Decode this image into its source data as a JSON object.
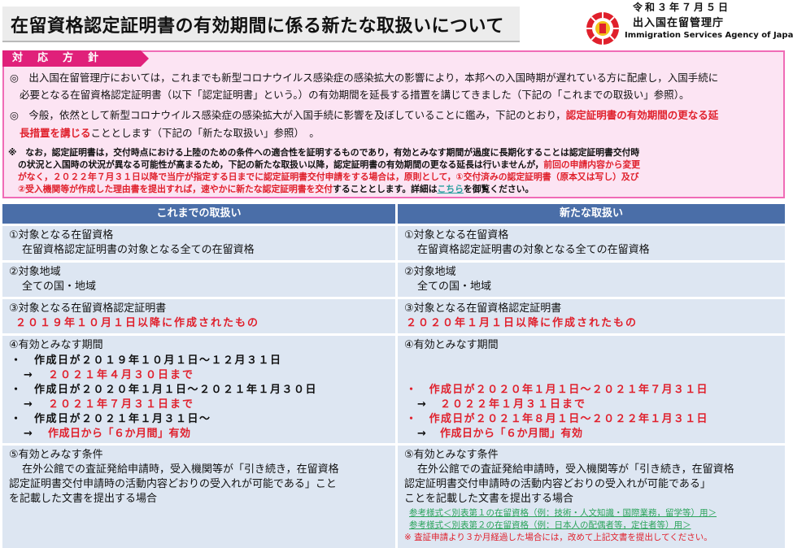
{
  "header": {
    "title": "在留資格認定証明書の有効期間に係る新たな取扱いについて",
    "date": "令和３年７月５日",
    "agency_ja": "出入国在留管理庁",
    "agency_en": "Immigration Services Agency of Japan",
    "logo_icon": "agency-emblem-icon"
  },
  "policy": {
    "tab_label": "対応方針",
    "line1": "◎　出入国在留管理庁においては，これまでも新型コロナウイルス感染症の感染拡大の影響により，本邦への入国時期が遅れている方に配慮し，入国手続に",
    "line2": "必要となる在留資格認定証明書（以下「認定証明書」という。）の有効期間を延長する措置を講じてきました（下記の「これまでの取扱い」参照）。",
    "line3a": "◎　今般，依然として新型コロナウイルス感染症の感染拡大が入国手続に影響を及ぼしていることに鑑み，下記のとおり，",
    "line3b": "認定証明書の有効期間の更なる延",
    "line4a": "長措置を講じる",
    "line4b": "こととします（下記の「新たな取扱い」参照）　。",
    "note1": "※　なお，認定証明書は，交付時点における上陸のための条件への適合性を証明するものであり，有効とみなす期間が過度に長期化することは認定証明書交付時",
    "note2a": "の状況と入国時の状況が異なる可能性が高まるため，下記の新たな取扱い以降，認定証明書の有効期間の更なる延長は行いませんが，",
    "note2b": "前回の申請内容から変更",
    "note3a": "がなく，２０２２年７月３１日以降で当庁が指定する日までに認定証明書交付申請をする場合は，原則として，①交付済みの認定証明書（原本又は写し）及び",
    "note4a": "②受入機関等が作成した理由書を提出すれば，",
    "note4b": "速やかに新たな認定証明書を交付",
    "note4c": "することとします。詳細は",
    "note4link": "こちら",
    "note4d": "を御覧ください。"
  },
  "table": {
    "left_header": "これまでの取扱い",
    "right_header": "新たな取扱い",
    "left": {
      "r1_title": "①対象となる在留資格",
      "r1_body": "在留資格認定証明書の対象となる全ての在留資格",
      "r2_title": "②対象地域",
      "r2_body": "全ての国・地域",
      "r3_title": "③対象となる在留資格認定証明書",
      "r3_body": "２０１９年１０月１日以降に作成されたもの",
      "r4_title": "④有効とみなす期間",
      "r4_l1": "・　作成日が２０１９年１０月１日～１２月３１日",
      "r4_l2a": "→",
      "r4_l2b": "２０２１年４月３０日まで",
      "r4_l3": "・　作成日が２０２０年１月１日～２０２１年１月３０日",
      "r4_l4a": "→",
      "r4_l4b": "２０２１年７月３１日まで",
      "r4_l5": "・　作成日が２０２１年１月３１日～",
      "r4_l6a": "→",
      "r4_l6b": "作成日から「６か月間」有効",
      "r5_title": "⑤有効とみなす条件",
      "r5_l1": "在外公館での査証発給申請時，受入機関等が「引き続き，在留資格",
      "r5_l2": "認定証明書交付申請時の活動内容どおりの受入れが可能である」こと",
      "r5_l3": "を記載した文書を提出する場合"
    },
    "right": {
      "r1_title": "①対象となる在留資格",
      "r1_body": "在留資格認定証明書の対象となる全ての在留資格",
      "r2_title": "②対象地域",
      "r2_body": "全ての国・地域",
      "r3_title": "③対象となる在留資格認定証明書",
      "r3_body": "２０２０年１月１日以降に作成されたもの",
      "r4_title": "④有効とみなす期間",
      "r4_l1": "・　作成日が２０２０年１月１日～２０２１年７月３１日",
      "r4_l2a": "→",
      "r4_l2b": "２０２２年１月３１日まで",
      "r4_l3": "・　作成日が２０２１年８月１日～２０２２年１月３１日",
      "r4_l4a": "→",
      "r4_l4b": "作成日から「６か月間」有効",
      "r5_title": "⑤有効とみなす条件",
      "r5_l1": "在外公館での査証発給申請時，受入機関等が「引き続き，在留資格",
      "r5_l2": "認定証明書交付申請時の活動内容どおりの受入れが可能である」",
      "r5_l3": "ことを記載した文書を提出する場合",
      "link1": "参考様式＜別表第１の在留資格（例：技術・人文知識・国際業務，留学等）用＞",
      "link2": "参考様式＜別表第２の在留資格（例：日本人の配偶者等，定住者等）用＞",
      "note": "※ 査証申請より３か月経過した場合には，改めて上記文書を提出してください。"
    }
  },
  "colors": {
    "pink_bg": "#fce4f3",
    "pink_border": "#f06bb6",
    "tab": "#e0207a",
    "header_blue": "#4a6ea8",
    "cell_bg": "#dde6f2",
    "red": "#e0202c",
    "green_link": "#2aa35a"
  }
}
